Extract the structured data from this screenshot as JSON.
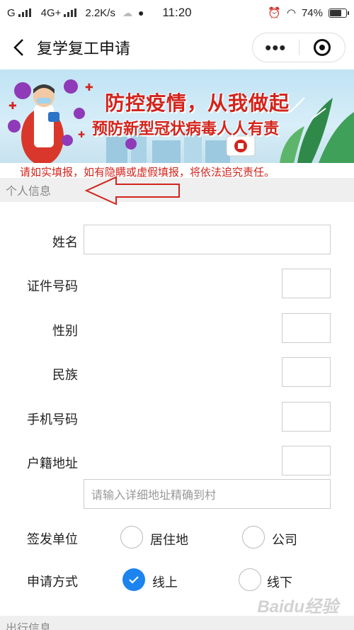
{
  "statusbar": {
    "carrier": "G",
    "network": "4G+",
    "speed": "2.2K/s",
    "time": "11:20",
    "battery": "74%",
    "battery_level": 0.74
  },
  "navbar": {
    "title": "复学复工申请",
    "more_icon": "•••"
  },
  "banner": {
    "line1": "防控疫情，从我做起",
    "line2": "预防新型冠状病毒人人有责"
  },
  "warning": "请如实填报，如有隐瞒或虚假填报，将依法追究责任。",
  "sections": {
    "personal": "个人信息",
    "travel": "出行信息"
  },
  "form": {
    "name_label": "姓名",
    "id_label": "证件号码",
    "gender_label": "性别",
    "ethnicity_label": "民族",
    "phone_label": "手机号码",
    "address_label": "户籍地址",
    "address_placeholder": "请输入详细地址精确到村",
    "issuer_label": "签发单位",
    "issuer_options": [
      "居住地",
      "公司"
    ],
    "method_label": "申请方式",
    "method_options": [
      "线上",
      "线下"
    ],
    "method_selected": "线上"
  },
  "watermark": "Baidu经验",
  "colors": {
    "accent": "#1d83ee",
    "warning": "#d2241c",
    "section_bg": "#efefef"
  }
}
